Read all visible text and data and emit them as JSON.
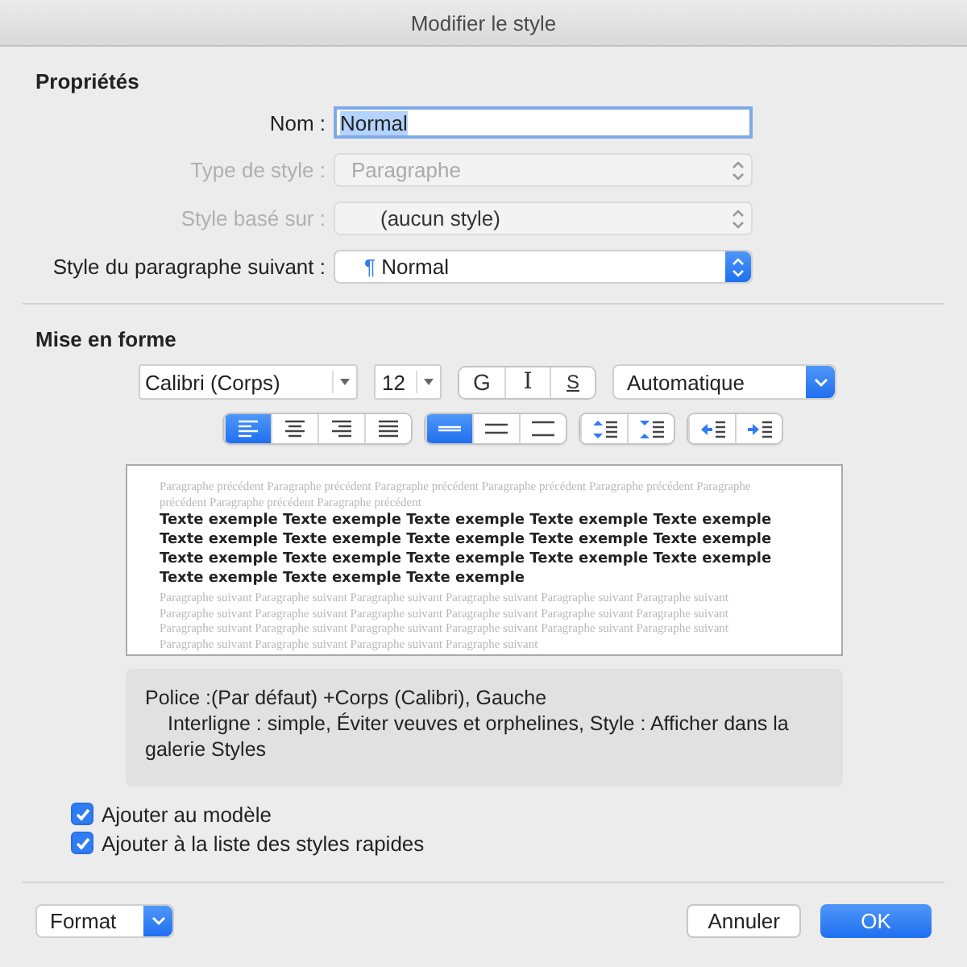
{
  "window": {
    "title": "Modifier le style"
  },
  "properties": {
    "heading": "Propriétés",
    "fields": [
      {
        "kind": "text",
        "label": "Nom :",
        "value": "Normal",
        "highlighted": true,
        "disabled": false
      },
      {
        "kind": "popup",
        "label": "Type de style :",
        "value": "Paragraphe",
        "disabled": true
      },
      {
        "kind": "popup",
        "label": "Style basé sur :",
        "value": "(aucun style)",
        "disabled": true
      },
      {
        "kind": "popup",
        "label": "Style du paragraphe suivant :",
        "marker": "¶",
        "value": "Normal",
        "disabled": false
      }
    ]
  },
  "formatting": {
    "heading": "Mise en forme",
    "font": "Calibri (Corps)",
    "size": "12",
    "style_buttons": [
      {
        "label": "G",
        "kind": "bold",
        "selected": false
      },
      {
        "label": "I",
        "kind": "italic",
        "selected": false
      },
      {
        "label": "S",
        "kind": "underline",
        "selected": false
      }
    ],
    "font_color": "Automatique",
    "alignment": [
      {
        "kind": "left",
        "selected": true
      },
      {
        "kind": "center",
        "selected": false
      },
      {
        "kind": "right",
        "selected": false
      },
      {
        "kind": "justify",
        "selected": false
      }
    ],
    "line_spacing": [
      {
        "kind": "single",
        "selected": true
      },
      {
        "kind": "one-half",
        "selected": false
      },
      {
        "kind": "double",
        "selected": false
      }
    ],
    "paragraph_spacing": [
      {
        "kind": "less"
      },
      {
        "kind": "more"
      }
    ],
    "indent": [
      {
        "kind": "decrease"
      },
      {
        "kind": "increase"
      }
    ]
  },
  "preview": {
    "previous": "Paragraphe précédent Paragraphe précédent Paragraphe précédent Paragraphe précédent Paragraphe précédent Paragraphe précédent Paragraphe précédent Paragraphe précédent",
    "sample": "Texte exemple Texte exemple Texte exemple Texte exemple Texte exemple Texte exemple Texte exemple Texte exemple Texte exemple Texte exemple Texte exemple Texte exemple Texte exemple Texte exemple Texte exemple Texte exemple Texte exemple Texte exemple",
    "next": "Paragraphe suivant Paragraphe suivant Paragraphe suivant Paragraphe suivant Paragraphe suivant Paragraphe suivant Paragraphe suivant Paragraphe suivant Paragraphe suivant Paragraphe suivant Paragraphe suivant Paragraphe suivant Paragraphe suivant Paragraphe suivant Paragraphe suivant Paragraphe suivant Paragraphe suivant Paragraphe suivant Paragraphe suivant Paragraphe suivant Paragraphe suivant Paragraphe suivant"
  },
  "description": {
    "lines": [
      "Police :(Par défaut) +Corps (Calibri), Gauche",
      "Interligne : simple, Éviter veuves et orphelines, Style : Afficher dans la galerie Styles"
    ]
  },
  "options": [
    {
      "label": "Ajouter au modèle",
      "checked": true
    },
    {
      "label": "Ajouter à la liste des styles rapides",
      "checked": true
    }
  ],
  "footer": {
    "menu": "Format",
    "cancel": "Annuler",
    "ok": "OK"
  }
}
